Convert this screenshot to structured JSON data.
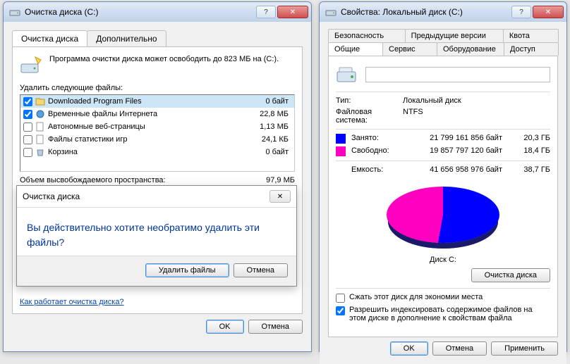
{
  "cleanup": {
    "title": "Очистка диска  (C:)",
    "tabs": {
      "main": "Очистка диска",
      "more": "Дополнительно"
    },
    "intro": "Программа очистки диска может освободить до 823 МБ на  (C:).",
    "delete_label": "Удалить следующие файлы:",
    "files": [
      {
        "checked": true,
        "name": "Downloaded Program Files",
        "size": "0 байт",
        "selected": true
      },
      {
        "checked": true,
        "name": "Временные файлы Интернета",
        "size": "22,8 МБ"
      },
      {
        "checked": false,
        "name": "Автономные веб-страницы",
        "size": "1,13 МБ"
      },
      {
        "checked": false,
        "name": "Файлы статистики игр",
        "size": "24,1 КБ"
      },
      {
        "checked": false,
        "name": "Корзина",
        "size": "0 байт"
      }
    ],
    "freed_label": "Объем высвобождаемого пространства:",
    "freed_value": "97,9 МБ",
    "howto_link": "Как работает очистка диска?",
    "ok": "OK",
    "cancel": "Отмена",
    "confirm": {
      "title": "Очистка диска",
      "message": "Вы действительно хотите необратимо удалить эти файлы?",
      "yes": "Удалить файлы",
      "no": "Отмена"
    }
  },
  "props": {
    "title": "Свойства: Локальный диск (C:)",
    "tabs": {
      "security": "Безопасность",
      "previous": "Предыдущие версии",
      "quota": "Квота",
      "general": "Общие",
      "service": "Сервис",
      "hardware": "Оборудование",
      "access": "Доступ"
    },
    "name_value": "",
    "type_label": "Тип:",
    "type_value": "Локальный диск",
    "fs_label": "Файловая система:",
    "fs_value": "NTFS",
    "used_label": "Занято:",
    "used_bytes": "21 799 161 856 байт",
    "used_gb": "20,3 ГБ",
    "free_label": "Свободно:",
    "free_bytes": "19 857 797 120 байт",
    "free_gb": "18,4 ГБ",
    "cap_label": "Емкость:",
    "cap_bytes": "41 656 958 976 байт",
    "cap_gb": "38,7 ГБ",
    "pie_label": "Диск C:",
    "cleanup_btn": "Очистка диска",
    "compress_label": "Сжать этот диск для экономии места",
    "index_label": "Разрешить индексировать содержимое файлов на этом диске в дополнение к свойствам файла",
    "ok": "OK",
    "cancel": "Отмена",
    "apply": "Применить"
  },
  "colors": {
    "used": "#0000ff",
    "free": "#ff00c0"
  },
  "chart_data": {
    "type": "pie",
    "title": "Диск C:",
    "series": [
      {
        "name": "Занято",
        "value_bytes": 21799161856,
        "value_gb": 20.3,
        "color": "#0000ff"
      },
      {
        "name": "Свободно",
        "value_bytes": 19857797120,
        "value_gb": 18.4,
        "color": "#ff00c0"
      }
    ],
    "total_bytes": 41656958976,
    "total_gb": 38.7
  }
}
